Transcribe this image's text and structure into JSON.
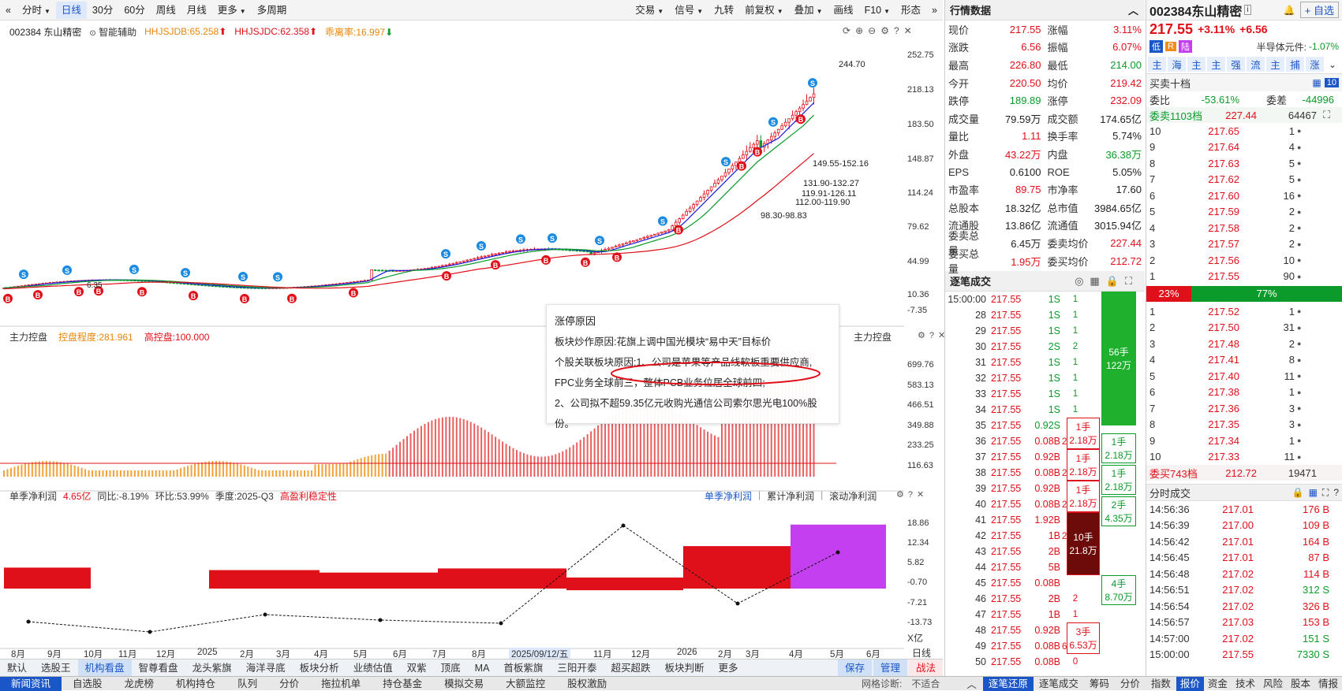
{
  "toolbar": {
    "nav_icon": "double-left-arrow",
    "left": [
      "分时",
      "日线",
      "30分",
      "60分",
      "周线",
      "月线",
      "更多",
      "多周期"
    ],
    "active": "日线",
    "right": [
      "交易",
      "信号",
      "九转",
      "前复权",
      "叠加",
      "画线",
      "F10",
      "形态"
    ],
    "end_icon": "double-right-arrow"
  },
  "info": {
    "code_name": "002384 东山精密",
    "assist": "智能辅助",
    "hhjsjdb": "HHJSJDB:65.258",
    "hhjsjdc": "HHJSJDC:62.358",
    "qlj": "乖离率:16.997"
  },
  "price_axis": [
    "252.75",
    "218.13",
    "183.50",
    "148.87",
    "114.24",
    "79.62",
    "44.99",
    "10.36",
    "-7.35"
  ],
  "price_annotations": [
    "244.70",
    "149.55-152.16",
    "131.90-132.27",
    "119.91-126.11",
    "112.00-119.90",
    "98.30-98.83",
    "6.35"
  ],
  "sub1": {
    "title": "主力控盘",
    "degree": "控盘程度:281.961",
    "high": "高控盘:100.000",
    "right_title": "主力控盘",
    "axis": [
      "699.76",
      "583.13",
      "466.51",
      "349.88",
      "233.25",
      "116.63"
    ]
  },
  "sub2": {
    "title": "单季净利润",
    "val": "4.65亿",
    "yoy": "同比:-8.19%",
    "qoq": "环比:53.99%",
    "season": "季度:2025-Q3",
    "tag": "高盈利稳定性",
    "tabs": [
      "单季净利润",
      "累计净利润",
      "滚动净利润"
    ],
    "axis": [
      "18.86",
      "12.34",
      "5.82",
      "-0.70",
      "-7.21",
      "-13.73"
    ],
    "unit": "X亿"
  },
  "date_axis": [
    "8月",
    "9月",
    "10月",
    "11月",
    "12月",
    "2025",
    "2月",
    "3月",
    "4月",
    "5月",
    "6月",
    "7月",
    "8月",
    "2025/09/12/五",
    "11月",
    "12月",
    "2026",
    "2月",
    "3月",
    "4月",
    "5月",
    "6月"
  ],
  "period_label": "日线",
  "popup": {
    "title": "涨停原因",
    "lines": [
      "板块炒作原因:花旗上调中国光模块“易中天”目标价",
      "个股关联板块原因:1、公司是苹果等产品线软板重要供应商,",
      "FPC业务全球前三，整体PCB业务位居全球前四;",
      "2、公司拟不超59.35亿元收购光通信公司索尔思光电100%股",
      "份。"
    ]
  },
  "indicator_tabs": [
    "默认",
    "选股王",
    "机构看盘",
    "智尊看盘",
    "龙头紫旗",
    "海洋寻底",
    "板块分析",
    "业绩估值",
    "双紫",
    "顶底",
    "MA",
    "首板紫旗",
    "三阳开泰",
    "超买超跌",
    "板块判断",
    "更多"
  ],
  "indicator_active": "机构看盘",
  "indicator_right": [
    "保存",
    "管理",
    "战法"
  ],
  "quote": {
    "header": "行情数据",
    "rows": [
      [
        "现价",
        "217.55",
        "涨幅",
        "3.11%"
      ],
      [
        "涨跌",
        "6.56",
        "振幅",
        "6.07%"
      ],
      [
        "最高",
        "226.80",
        "最低",
        "214.00"
      ],
      [
        "今开",
        "220.50",
        "均价",
        "219.42"
      ],
      [
        "跌停",
        "189.89",
        "涨停",
        "232.09"
      ],
      [
        "成交量",
        "79.59万",
        "成交额",
        "174.65亿"
      ],
      [
        "量比",
        "1.11",
        "换手率",
        "5.74%"
      ],
      [
        "外盘",
        "43.22万",
        "内盘",
        "36.38万"
      ],
      [
        "EPS",
        "0.6100",
        "ROE",
        "5.05%"
      ],
      [
        "市盈率",
        "89.75",
        "市净率",
        "17.60"
      ],
      [
        "总股本",
        "18.32亿",
        "总市值",
        "3984.65亿"
      ],
      [
        "流通股",
        "13.86亿",
        "流通值",
        "3015.94亿"
      ],
      [
        "委卖总量",
        "6.45万",
        "委卖均价",
        "227.44"
      ],
      [
        "委买总量",
        "1.95万",
        "委买均价",
        "212.72"
      ]
    ]
  },
  "ticks": {
    "header": "逐笔成交",
    "rows": [
      [
        "15:00:00",
        "217.55",
        "1S",
        "1"
      ],
      [
        "28",
        "217.55",
        "1S",
        "1"
      ],
      [
        "29",
        "217.55",
        "1S",
        "1"
      ],
      [
        "30",
        "217.55",
        "2S",
        "2"
      ],
      [
        "31",
        "217.55",
        "1S",
        "1"
      ],
      [
        "32",
        "217.55",
        "1S",
        "1"
      ],
      [
        "33",
        "217.55",
        "1S",
        "1"
      ],
      [
        "34",
        "217.55",
        "1S",
        "1"
      ],
      [
        "35",
        "217.55",
        "0.92S",
        "1手"
      ],
      [
        "36",
        "217.55",
        "0.08B",
        "2.18万"
      ],
      [
        "37",
        "217.55",
        "0.92B",
        "1手"
      ],
      [
        "38",
        "217.55",
        "0.08B",
        "2.18万"
      ],
      [
        "39",
        "217.55",
        "0.92B",
        "1手"
      ],
      [
        "40",
        "217.55",
        "0.08B",
        "2.18万"
      ],
      [
        "41",
        "217.55",
        "1.92B",
        "10手"
      ],
      [
        "42",
        "217.55",
        "1B",
        "21.8万"
      ],
      [
        "43",
        "217.55",
        "2B",
        "2"
      ],
      [
        "44",
        "217.55",
        "5B",
        "5"
      ],
      [
        "45",
        "217.55",
        "0.08B",
        ""
      ],
      [
        "46",
        "217.55",
        "2B",
        "2"
      ],
      [
        "47",
        "217.55",
        "1B",
        "1"
      ],
      [
        "48",
        "217.55",
        "0.92B",
        "3手"
      ],
      [
        "49",
        "217.55",
        "0.08B",
        "6.53万"
      ],
      [
        "50",
        "217.55",
        "0.08B",
        "0"
      ]
    ],
    "green_block": [
      "56手",
      "122万"
    ],
    "green_small": [
      [
        "1手",
        "2.18万"
      ],
      [
        "1手",
        "2.18万"
      ],
      [
        "2手",
        "4.35万"
      ],
      [
        "4手",
        "8.70万"
      ]
    ]
  },
  "stock": {
    "title": "002384东山精密",
    "price": "217.55",
    "chg": "+3.11%",
    "chgv": "+6.56",
    "tags": [
      "低",
      "R",
      "陆"
    ],
    "sector": "半导体元件:",
    "sector_chg": "-1.07%",
    "add": "+ 自选",
    "quick": [
      "主",
      "海",
      "主",
      "主",
      "强",
      "流",
      "主",
      "捕",
      "涨"
    ]
  },
  "orderbook": {
    "title": "买卖十档",
    "wb": [
      "委比",
      "-53.61%",
      "委差",
      "-44996"
    ],
    "sell_total": [
      "委卖1103档",
      "227.44",
      "64467"
    ],
    "sells": [
      [
        "10",
        "217.65",
        "1"
      ],
      [
        "9",
        "217.64",
        "4"
      ],
      [
        "8",
        "217.63",
        "5"
      ],
      [
        "7",
        "217.62",
        "5"
      ],
      [
        "6",
        "217.60",
        "16"
      ],
      [
        "5",
        "217.59",
        "2"
      ],
      [
        "4",
        "217.58",
        "2"
      ],
      [
        "3",
        "217.57",
        "2"
      ],
      [
        "2",
        "217.56",
        "10"
      ],
      [
        "1",
        "217.55",
        "90"
      ]
    ],
    "ratio": [
      "23%",
      "77%"
    ],
    "buys": [
      [
        "1",
        "217.52",
        "1"
      ],
      [
        "2",
        "217.50",
        "31"
      ],
      [
        "3",
        "217.48",
        "2"
      ],
      [
        "4",
        "217.41",
        "8"
      ],
      [
        "5",
        "217.40",
        "11"
      ],
      [
        "6",
        "217.38",
        "1"
      ],
      [
        "7",
        "217.36",
        "3"
      ],
      [
        "8",
        "217.35",
        "3"
      ],
      [
        "9",
        "217.34",
        "1"
      ],
      [
        "10",
        "217.33",
        "11"
      ]
    ],
    "buy_total": [
      "委买743档",
      "212.72",
      "19471"
    ]
  },
  "minute_trades": {
    "title": "分时成交",
    "rows": [
      [
        "14:56:36",
        "217.01",
        "176 B"
      ],
      [
        "14:56:39",
        "217.00",
        "109 B"
      ],
      [
        "14:56:42",
        "217.01",
        "164 B"
      ],
      [
        "14:56:45",
        "217.01",
        "87 B"
      ],
      [
        "14:56:48",
        "217.02",
        "114 B"
      ],
      [
        "14:56:51",
        "217.02",
        "312 S"
      ],
      [
        "14:56:54",
        "217.02",
        "326 B"
      ],
      [
        "14:56:57",
        "217.03",
        "153 B"
      ],
      [
        "14:57:00",
        "217.02",
        "151 S"
      ],
      [
        "15:00:00",
        "217.55",
        "7330 S"
      ]
    ]
  },
  "bottom_tabs": [
    "新闻资讯",
    "自选股",
    "龙虎榜",
    "机构持仓",
    "队列",
    "分价",
    "拖拉机单",
    "持仓基金",
    "模拟交易",
    "大额监控",
    "股权激励"
  ],
  "bottom_active": "新闻资讯",
  "bottom_right": [
    "网格诊断:",
    "不适合"
  ],
  "bottom_tabs2": [
    "逐笔还原",
    "逐笔成交",
    "筹码",
    "分价",
    "指数"
  ],
  "bottom_tabs3": [
    "报价",
    "资金",
    "技术",
    "风险",
    "股本",
    "情报"
  ],
  "colors": {
    "red": "#e0101a",
    "green": "#0a9b2a",
    "blue": "#1a56c8",
    "purple": "#c43ff0"
  }
}
